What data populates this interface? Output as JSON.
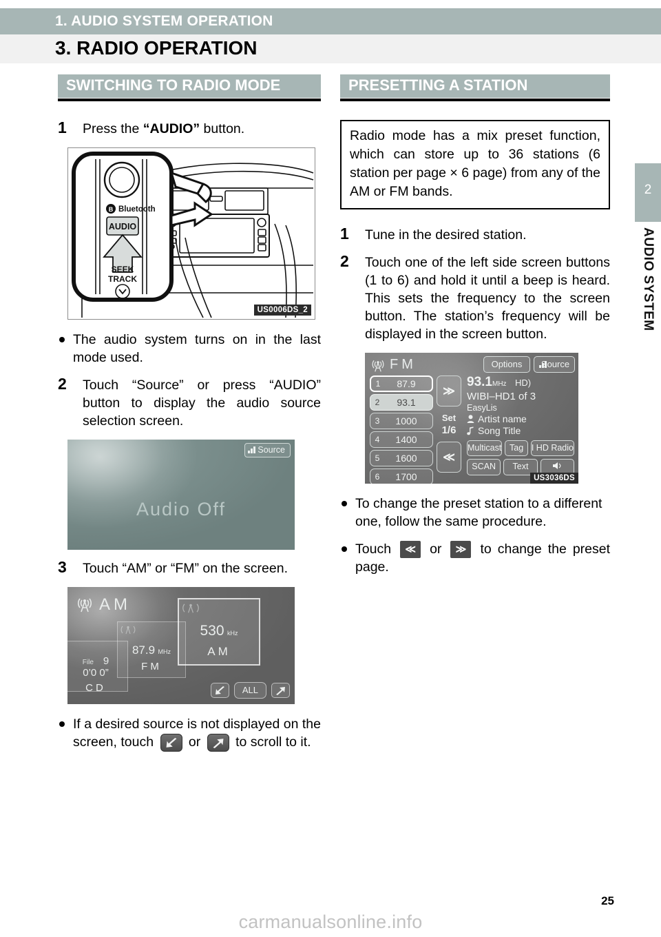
{
  "header": {
    "chapter": "1. AUDIO SYSTEM OPERATION",
    "section_title": "3. RADIO OPERATION"
  },
  "side_tab": {
    "number": "2",
    "label": "AUDIO SYSTEM"
  },
  "left_column": {
    "section_header": "SWITCHING TO RADIO MODE",
    "step1": {
      "num": "1",
      "text_before": "Press the ",
      "bold": "“AUDIO”",
      "text_after": " button."
    },
    "dash_figure": {
      "caption": "US0006DS_2",
      "bluetooth_label": "Bluetooth",
      "audio_button": "AUDIO",
      "seek_label": "SEEK",
      "track_label": "TRACK"
    },
    "bullet1": "The audio system turns on in the last mode used.",
    "step2": {
      "num": "2",
      "text": "Touch “Source” or press “AUDIO” button to display the audio source selection screen."
    },
    "audio_off_screen": {
      "source_button": "Source",
      "status": "Audio Off"
    },
    "step3": {
      "num": "3",
      "text": "Touch “AM” or “FM” on the screen."
    },
    "source_screen": {
      "band_top": "AM",
      "cards": [
        {
          "line1_label": "File",
          "line1_value": "9",
          "line2": "0’0 0”",
          "band": "CD"
        },
        {
          "freq": "87.9",
          "unit": "MHz",
          "band": "FM"
        },
        {
          "freq": "530",
          "unit": "kHz",
          "band": "AM"
        }
      ],
      "all_button": "ALL"
    },
    "bullet2": {
      "part1": "If a desired source is not displayed on the screen, touch",
      "part2": "or",
      "part3": "to scroll to it."
    }
  },
  "right_column": {
    "section_header": "PRESETTING A STATION",
    "note": "Radio mode has a mix preset function, which can store up to 36 stations (6 station per page × 6 page) from any of the AM or FM bands.",
    "step1": {
      "num": "1",
      "text": "Tune in the desired station."
    },
    "step2": {
      "num": "2",
      "text": "Touch one of the left side screen buttons (1 to 6) and hold it until a beep is heard. This sets the frequency to the screen button. The station’s frequency will be displayed in the screen button."
    },
    "radio_screen": {
      "caption": "US3036DS",
      "band": "FM",
      "options_button": "Options",
      "source_button": "Source",
      "presets": [
        {
          "index": "1",
          "value": "87.9",
          "selected": false
        },
        {
          "index": "2",
          "value": "93.1",
          "selected": true
        },
        {
          "index": "3",
          "value": "1000",
          "selected": false
        },
        {
          "index": "4",
          "value": "1400",
          "selected": false
        },
        {
          "index": "5",
          "value": "1600",
          "selected": false
        },
        {
          "index": "6",
          "value": "1700",
          "selected": false
        }
      ],
      "next_button": "≫",
      "prev_button": "≪",
      "set_label": "Set",
      "page_label": "1/6",
      "frequency": "93.1",
      "frequency_unit": "MHz",
      "hd_icon": "HD)",
      "station": "WIBI–HD1 of 3",
      "genre": "EasyLis",
      "artist": "Artist name",
      "song": "Song Title",
      "buttons": [
        "Multicast",
        "Tag",
        "I HD Radio",
        "SCAN",
        "Text"
      ]
    },
    "bullet1": "To change the preset station to a different one, follow the same procedure.",
    "bullet2": {
      "part1": "Touch",
      "chip1": "≪",
      "part2": "or",
      "chip2": "≫",
      "part3": "to change the preset page."
    }
  },
  "footer": {
    "page_number": "25",
    "watermark": "carmanualsonline.info"
  }
}
